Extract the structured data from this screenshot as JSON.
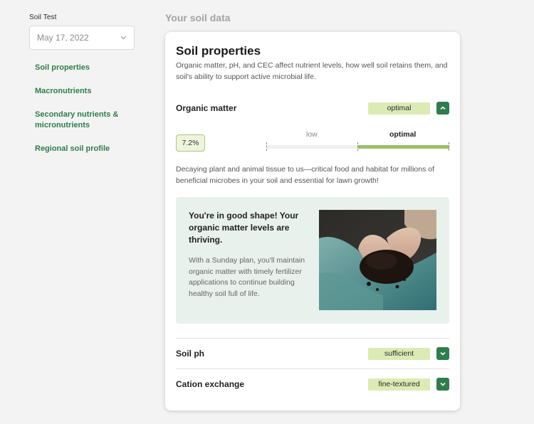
{
  "sidebar": {
    "soil_test_label": "Soil Test",
    "date_value": "May 17, 2022",
    "nav": [
      {
        "label": "Soil properties"
      },
      {
        "label": "Macronutrients"
      },
      {
        "label": "Secondary nutrients & micronutrients"
      },
      {
        "label": "Regional soil profile"
      }
    ]
  },
  "main": {
    "section_title": "Your soil data",
    "card": {
      "title": "Soil properties",
      "description": "Organic matter, pH, and CEC affect nutrient levels, how well soil retains them, and soil's ability to support active microbial life.",
      "organic_matter": {
        "label": "Organic matter",
        "status": "optimal",
        "value": "7.2%",
        "gauge": {
          "low_label": "low",
          "optimal_label": "optimal",
          "active_zone": "optimal"
        },
        "description": "Decaying plant and animal tissue to us—critical food and habitat for millions of beneficial microbes in your soil and essential for lawn growth!",
        "callout": {
          "headline": "You're in good shape! Your organic matter levels are thriving.",
          "body": "With a Sunday plan, you'll maintain organic matter with timely fertilizer applications to continue building healthy soil full of life."
        }
      },
      "soil_ph": {
        "label": "Soil ph",
        "status": "sufficient"
      },
      "cation_exchange": {
        "label": "Cation exchange",
        "status": "fine-textured"
      }
    }
  },
  "colors": {
    "accent_green": "#2e7d4b",
    "badge_bg": "#dcebb5",
    "callout_bg": "#e8f1ec",
    "gauge_fill": "#9cc06b"
  },
  "icons": {
    "expand_open": "chevron-up-icon",
    "expand_closed": "chevron-down-icon",
    "select": "chevron-down-icon"
  }
}
